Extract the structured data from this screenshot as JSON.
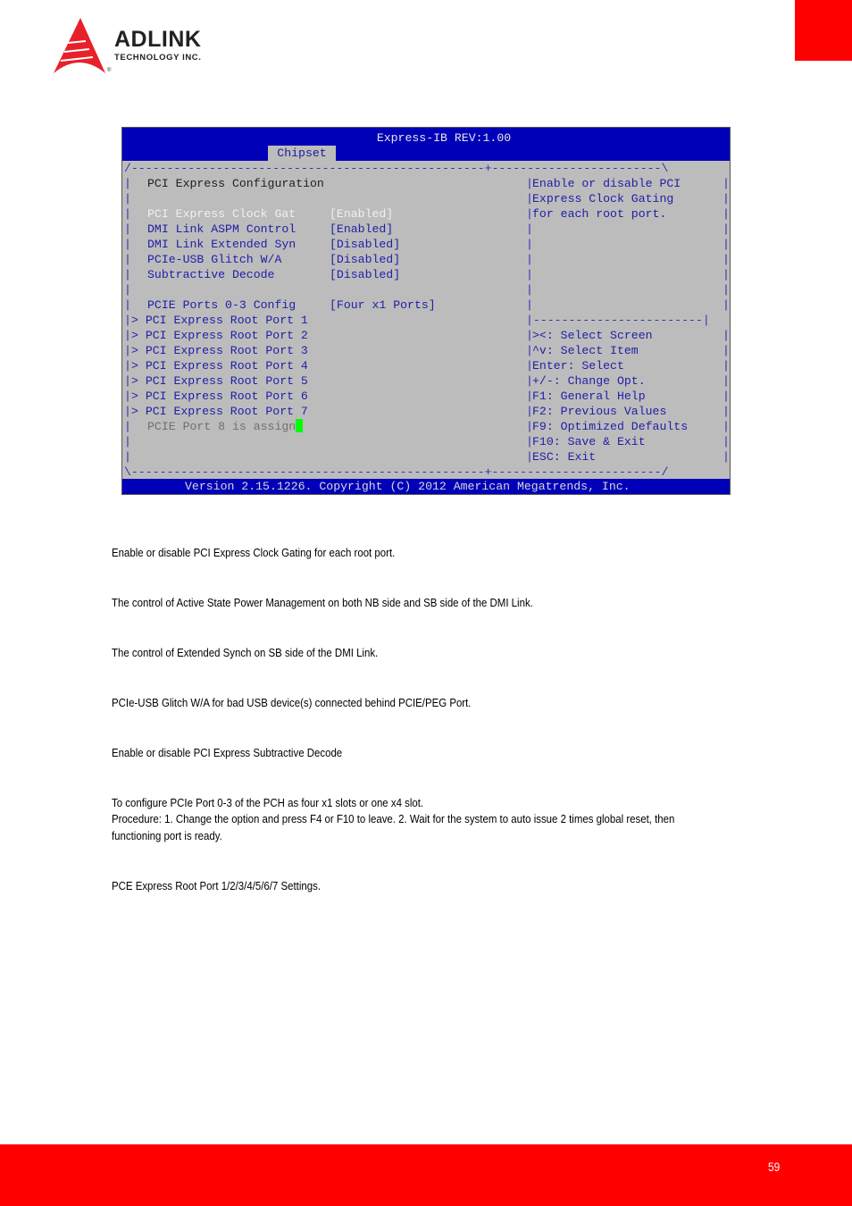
{
  "header": {
    "brand": "ADLINK",
    "brand_sub": "TECHNOLOGY INC.",
    "registered_mark": "®"
  },
  "bios": {
    "title": "Express-IB REV:1.00",
    "active_tab": "Chipset",
    "section_title": "PCI Express Configuration",
    "settings": [
      {
        "label": "PCI Express Clock Gat",
        "value": "[Enabled]",
        "selected": true
      },
      {
        "label": "DMI Link ASPM Control",
        "value": "[Enabled]"
      },
      {
        "label": "DMI Link Extended Syn",
        "value": "[Disabled]"
      },
      {
        "label": "PCIe-USB Glitch W/A",
        "value": "[Disabled]"
      },
      {
        "label": "Subtractive Decode",
        "value": "[Disabled]"
      }
    ],
    "ports_config": {
      "label": "PCIE Ports 0-3 Config",
      "value": "[Four x1 Ports]"
    },
    "submenus": [
      "> PCI Express Root Port 1",
      "> PCI Express Root Port 2",
      "> PCI Express Root Port 3",
      "> PCI Express Root Port 4",
      "> PCI Express Root Port 5",
      "> PCI Express Root Port 6",
      "> PCI Express Root Port 7"
    ],
    "port8_note": "PCIE Port 8 is assign",
    "help_text": [
      "Enable or disable PCI",
      "Express Clock Gating",
      "for each root port."
    ],
    "keys": [
      "><: Select Screen",
      "^v: Select Item",
      "Enter: Select",
      "+/-: Change Opt.",
      "F1: General Help",
      "F2: Previous Values",
      "F9: Optimized Defaults",
      "F10: Save & Exit",
      "ESC: Exit"
    ],
    "footer": "Version 2.15.1226. Copyright (C) 2012 American Megatrends, Inc.",
    "colors": {
      "header_bg": "#0000b8",
      "body_bg": "#bcbcbc",
      "cursor": "#00ff00"
    }
  },
  "descriptions": [
    "Enable or disable PCI Express Clock Gating for each root port.",
    "The control of Active State Power Management on both NB side and SB side of the DMI Link.",
    "The control of Extended Synch on SB side of the DMI Link.",
    "PCIe-USB Glitch W/A for bad USB device(s) connected behind PCIE/PEG Port.",
    "Enable or disable PCI Express Subtractive Decode",
    "To configure PCIe Port 0-3 of the PCH as four x1 slots or one x4 slot.",
    "Procedure: 1. Change the option and press F4 or F10 to leave. 2. Wait for the system to auto issue 2 times global reset, then",
    "functioning port is ready.",
    "PCE Express Root Port 1/2/3/4/5/6/7 Settings."
  ],
  "footer": {
    "page_number": "59",
    "accent": "#ff0000"
  }
}
